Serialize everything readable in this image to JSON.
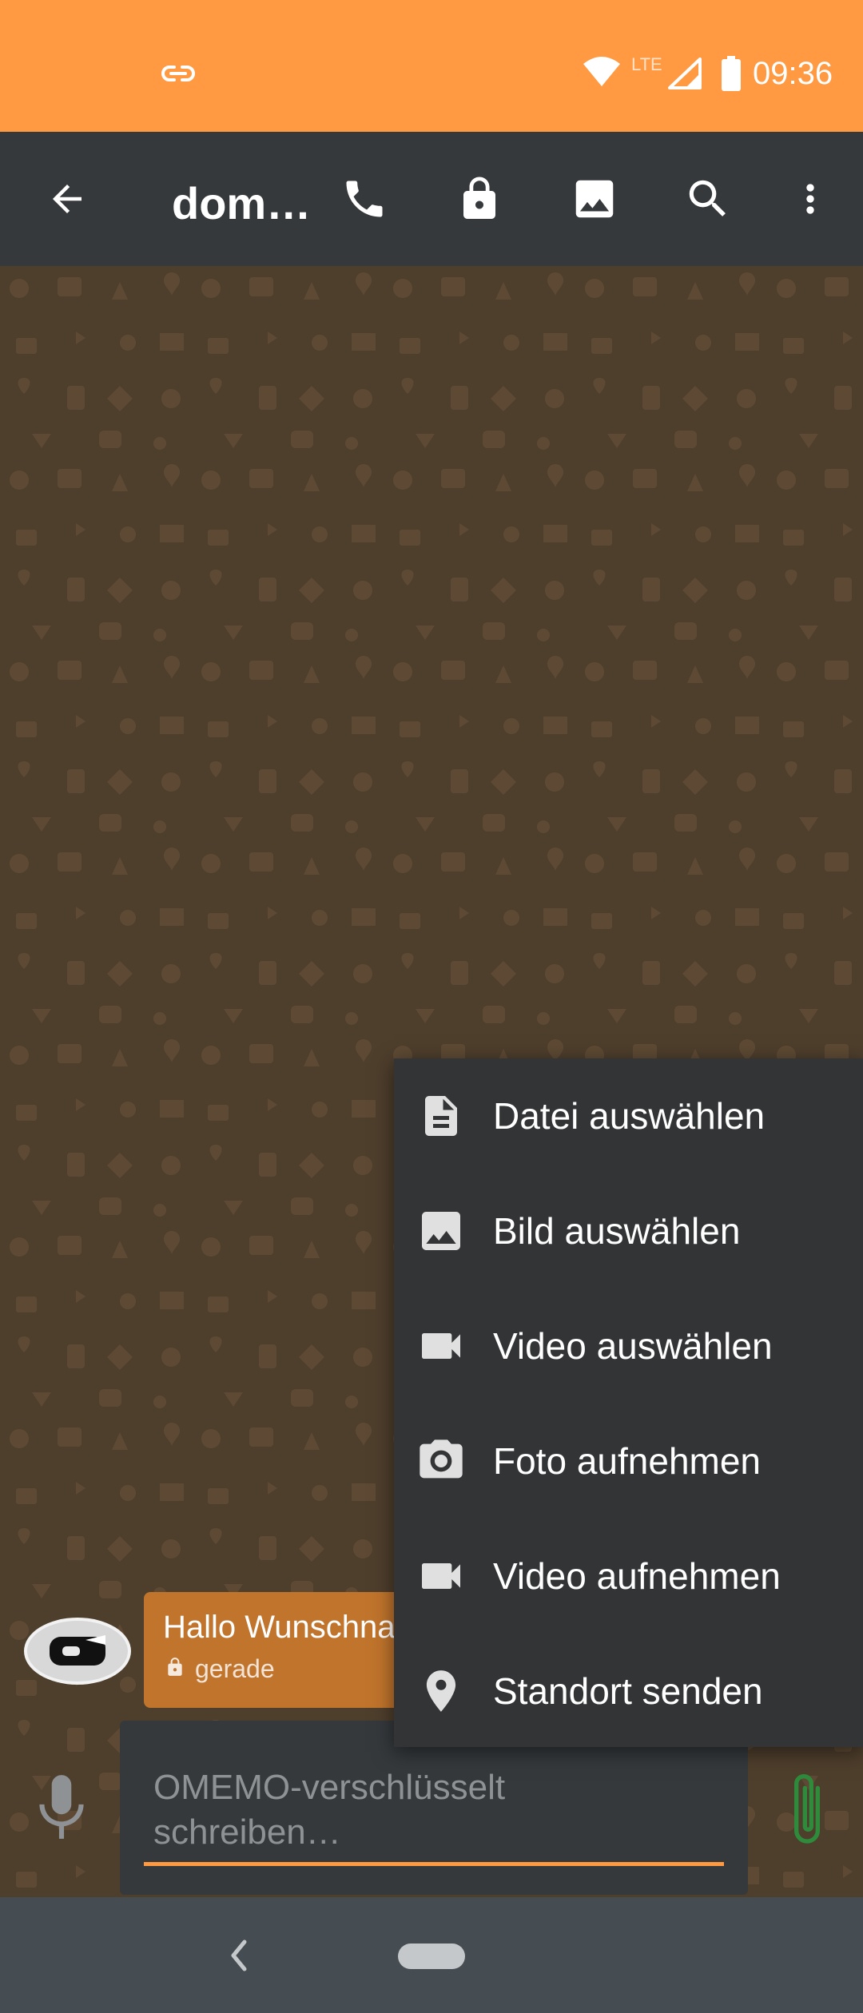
{
  "status_bar": {
    "time": "09:36",
    "network": "LTE",
    "icons": [
      "link-icon",
      "wifi-icon",
      "signal-icon",
      "battery-icon"
    ],
    "background": "#ff9a42"
  },
  "toolbar": {
    "title": "dom…",
    "icons": [
      "back-arrow-icon",
      "phone-icon",
      "lock-icon",
      "image-icon",
      "search-icon",
      "more-vert-icon"
    ],
    "background": "#35393c"
  },
  "conversation": {
    "background": "#4e3e2c",
    "messages": [
      {
        "direction": "incoming",
        "text": "Hallo Wunschna",
        "time": "gerade",
        "encrypted": true,
        "bubble_color": "#c0742c"
      }
    ]
  },
  "composer": {
    "placeholder": "OMEMO-verschlüsselt schreiben…",
    "accent": "#ff9a42",
    "icons": [
      "microphone-icon",
      "paperclip-icon"
    ]
  },
  "attach_menu": {
    "items": [
      {
        "label": "Datei auswählen",
        "icon": "file-icon"
      },
      {
        "label": "Bild auswählen",
        "icon": "image-icon"
      },
      {
        "label": "Video auswählen",
        "icon": "videocam-icon"
      },
      {
        "label": "Foto aufnehmen",
        "icon": "camera-icon"
      },
      {
        "label": "Video aufnehmen",
        "icon": "videocam-icon"
      },
      {
        "label": "Standort senden",
        "icon": "location-pin-icon"
      }
    ]
  }
}
